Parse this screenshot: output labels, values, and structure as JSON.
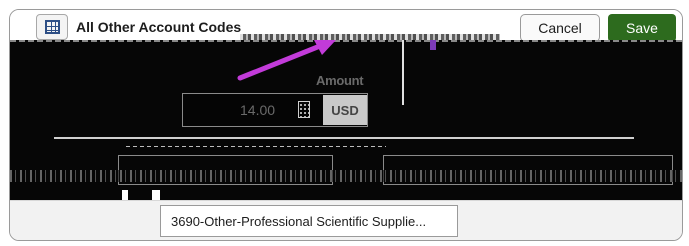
{
  "header": {
    "title": "All Other Account Codes",
    "cancel_label": "Cancel",
    "save_label": "Save",
    "icons": {
      "grid": "grid-icon"
    }
  },
  "amount": {
    "label": "Amount",
    "value": "14.00",
    "currency": "USD",
    "icon": "calculator-icon"
  },
  "account": {
    "selected": "3690-Other-Professional Scientific Supplie..."
  },
  "colors": {
    "save_button": "#2d6b1e",
    "annotation_arrow": "#c23bd9"
  }
}
